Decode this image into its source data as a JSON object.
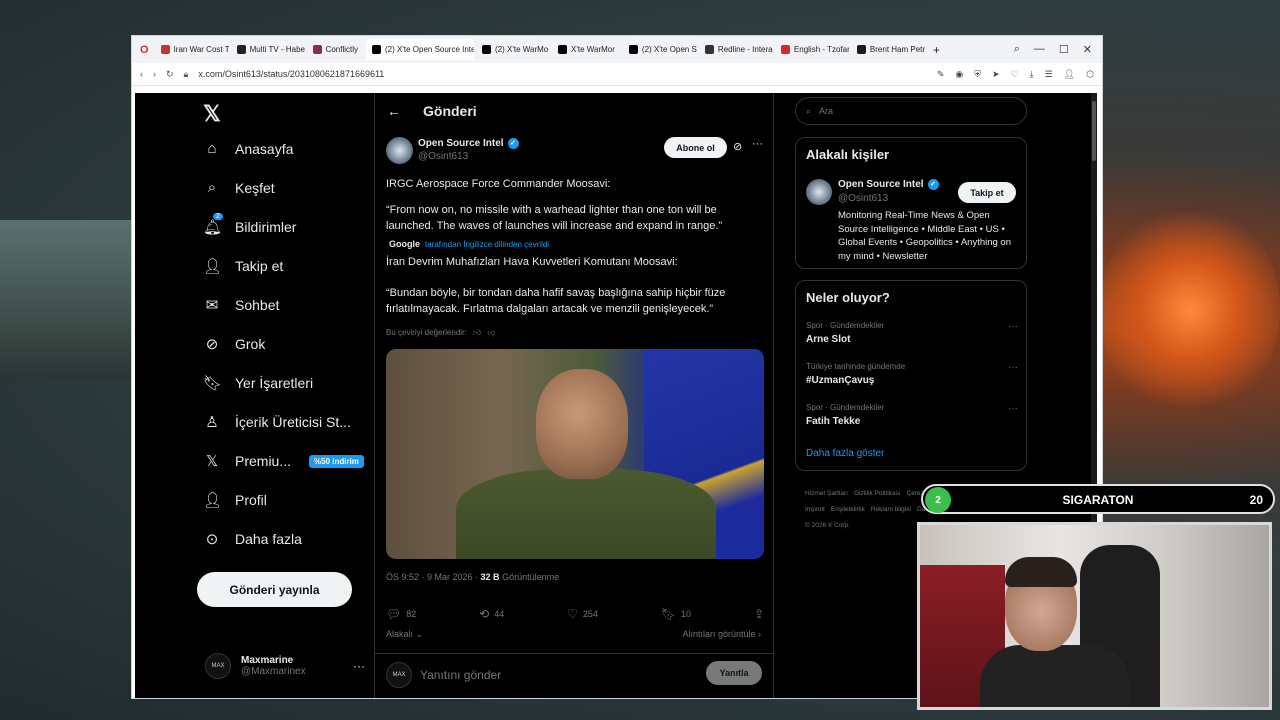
{
  "browser": {
    "tabs": [
      {
        "label": "Iran War Cost T",
        "color": "#c0392b",
        "active": false
      },
      {
        "label": "Multi TV - Habe",
        "color": "#222222",
        "active": false
      },
      {
        "label": "Conflictly",
        "color": "#8e2b55",
        "active": false
      },
      {
        "label": "(2) X'te Open Source Intel",
        "color": "#000000",
        "active": true
      },
      {
        "label": "(2) X'te WarMo",
        "color": "#000000",
        "active": false
      },
      {
        "label": "X'te WarMor",
        "color": "#000000",
        "active": false
      },
      {
        "label": "(2) X'te Open S",
        "color": "#000000",
        "active": false
      },
      {
        "label": "Redline - Intera",
        "color": "#333333",
        "active": false
      },
      {
        "label": "English - Tzofar",
        "color": "#d62828",
        "active": false
      },
      {
        "label": "Brent Ham Petro",
        "color": "#1b1b1b",
        "active": false
      }
    ],
    "new_tab": "+",
    "url": "x.com/Osint613/status/2031080621871669611"
  },
  "nav": {
    "items": [
      {
        "label": "Anasayfa",
        "icon": "home-icon",
        "glyph": "⌂"
      },
      {
        "label": "Keşfet",
        "icon": "search-icon",
        "glyph": "⌕"
      },
      {
        "label": "Bildirimler",
        "icon": "bell-icon",
        "glyph": "🔔︎",
        "badge": "2"
      },
      {
        "label": "Takip et",
        "icon": "add-person-icon",
        "glyph": "👤︎"
      },
      {
        "label": "Sohbet",
        "icon": "mail-icon",
        "glyph": "✉"
      },
      {
        "label": "Grok",
        "icon": "grok-icon",
        "glyph": "⊘"
      },
      {
        "label": "Yer İşaretleri",
        "icon": "bookmark-icon",
        "glyph": "🔖︎"
      },
      {
        "label": "İçerik Üreticisi St...",
        "icon": "creator-icon",
        "glyph": "♙"
      },
      {
        "label": "Premiu...",
        "icon": "x-logo-icon",
        "glyph": "𝕏",
        "promo": "%50 indirim"
      },
      {
        "label": "Profil",
        "icon": "profile-icon",
        "glyph": "👤︎"
      },
      {
        "label": "Daha fazla",
        "icon": "more-circle-icon",
        "glyph": "⊙"
      }
    ],
    "post_button": "Gönderi yayınla",
    "user": {
      "name": "Maxmarine",
      "handle": "@Maxmarinex",
      "avatar_text": "MAX"
    }
  },
  "post": {
    "header": "Gönderi",
    "author": "Open Source Intel",
    "handle": "@Osint613",
    "follow": "Abone ol",
    "line1": "IRGC Aerospace Force Commander Moosavi:",
    "line2": "“From now on, no missile with a warhead lighter than one ton will be launched. The waves of launches will increase and expand in range.”",
    "translated_by": "Google",
    "translated_note": "tarafından İngilizce dilinden çevrildi",
    "tr_line1": "İran Devrim Muhafızları Hava Kuvvetleri Komutanı Moosavi:",
    "tr_line2": "“Bundan böyle, bir tondan daha hafif savaş başlığına sahip hiçbir füze fırlatılmayacak. Fırlatma dalgaları artacak ve menzili genişleyecek.”",
    "rate": "Bu çeviriyi değerlendir:",
    "time": "ÖS 9:52 · 9 Mar 2026 · ",
    "views": "32 B",
    "views_label": " Görüntülenme",
    "replies": "82",
    "reposts": "44",
    "likes": "254",
    "bookmarks": "10",
    "relevant": "Alakalı",
    "quotes": "Alıntıları görüntüle",
    "reply_placeholder": "Yanıtını gönder",
    "reply_button": "Yanıtla"
  },
  "right": {
    "search_placeholder": "Ara",
    "related_title": "Alakalı kişiler",
    "related_name": "Open Source Intel",
    "related_handle": "@Osint613",
    "related_follow": "Takip et",
    "related_bio": "Monitoring Real-Time News & Open Source Intelligence • Middle East • US • Global Events • Geopolitics • Anything on my mind • Newsletter",
    "trends_title": "Neler oluyor?",
    "trends": [
      {
        "category": "Spor · Gündemdekiler",
        "name": "Arne Slot"
      },
      {
        "category": "Türkiye tarihinde gündemde",
        "name": "#UzmanÇavuş"
      },
      {
        "category": "Spor · Gündemdekiler",
        "name": "Fatih Tekke"
      }
    ],
    "show_more": "Daha fazla göster",
    "footer": [
      "Hizmet Şartları",
      "Gizlilik Politikası",
      "Çerez Politikası",
      "Imprint",
      "Erişilebilirlik",
      "Reklam bilgisi",
      "Daha fazla ...",
      "© 2026 X Corp."
    ]
  },
  "overlay": {
    "level": "2",
    "label": "SIGARATON",
    "count": "20"
  }
}
